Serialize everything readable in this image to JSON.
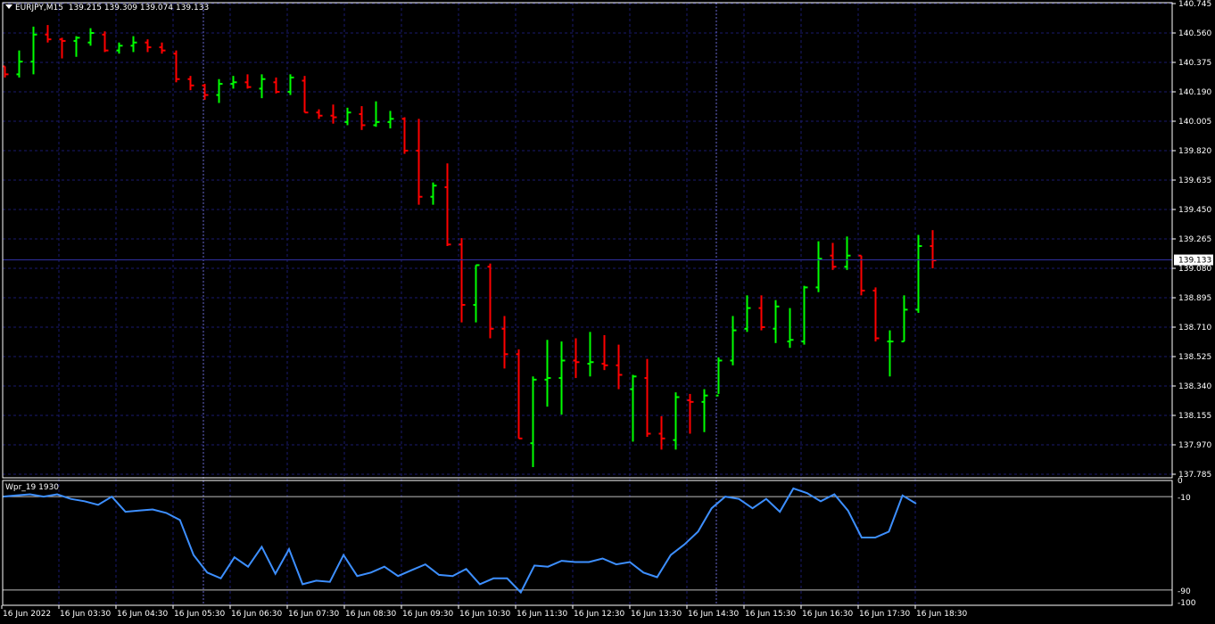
{
  "header": {
    "symbol": "EURJPY,M15",
    "ohlc": "139.215 139.309 139.074 139.133"
  },
  "indicator": {
    "label": "Wpr_19 1930",
    "levels_labels": [
      "0",
      "-10",
      "-90",
      "-100"
    ]
  },
  "current_price_label": "139.133",
  "colors": {
    "background": "#000000",
    "grid": "#1a1a6e",
    "bull": "#00ff00",
    "bear": "#ff0000",
    "wpr_line": "#3d8fff",
    "axis": "#ffffff",
    "separator": "#8080ff"
  },
  "chart_data": [
    {
      "type": "ohlc",
      "title": "EURJPY,M15",
      "ylim": [
        137.785,
        140.745
      ],
      "y_ticks": [
        "140.745",
        "140.560",
        "140.375",
        "140.190",
        "140.005",
        "139.820",
        "139.635",
        "139.450",
        "139.265",
        "139.080",
        "138.895",
        "138.710",
        "138.525",
        "138.340",
        "138.155",
        "137.970",
        "137.785"
      ],
      "x_ticks": [
        "16 Jun 2022",
        "16 Jun 03:30",
        "16 Jun 04:30",
        "16 Jun 05:30",
        "16 Jun 06:30",
        "16 Jun 07:30",
        "16 Jun 08:30",
        "16 Jun 09:30",
        "16 Jun 10:30",
        "16 Jun 11:30",
        "16 Jun 12:30",
        "16 Jun 13:30",
        "16 Jun 14:30",
        "16 Jun 15:30",
        "16 Jun 16:30",
        "16 Jun 17:30",
        "16 Jun 18:30"
      ],
      "current_price": 139.133,
      "bars": [
        [
          140.35,
          140.35,
          140.28,
          140.3
        ],
        [
          140.3,
          140.45,
          140.28,
          140.38
        ],
        [
          140.38,
          140.6,
          140.3,
          140.55
        ],
        [
          140.55,
          140.61,
          140.5,
          140.52
        ],
        [
          140.52,
          140.53,
          140.4,
          140.51
        ],
        [
          140.51,
          140.54,
          140.41,
          140.53
        ],
        [
          140.5,
          140.59,
          140.48,
          140.56
        ],
        [
          140.55,
          140.57,
          140.44,
          140.45
        ],
        [
          140.45,
          140.5,
          140.43,
          140.48
        ],
        [
          140.48,
          140.54,
          140.44,
          140.5
        ],
        [
          140.5,
          140.52,
          140.44,
          140.47
        ],
        [
          140.47,
          140.5,
          140.43,
          140.45
        ],
        [
          140.43,
          140.45,
          140.25,
          140.27
        ],
        [
          140.27,
          140.29,
          140.2,
          140.23
        ],
        [
          140.23,
          140.24,
          140.14,
          140.17
        ],
        [
          140.17,
          140.27,
          140.12,
          140.24
        ],
        [
          140.24,
          140.29,
          140.21,
          140.25
        ],
        [
          140.25,
          140.3,
          140.21,
          140.22
        ],
        [
          140.21,
          140.3,
          140.15,
          140.27
        ],
        [
          140.25,
          140.28,
          140.18,
          140.19
        ],
        [
          140.19,
          140.3,
          140.17,
          140.28
        ],
        [
          140.26,
          140.29,
          140.06,
          140.06
        ],
        [
          140.06,
          140.08,
          140.02,
          140.04
        ],
        [
          140.04,
          140.11,
          139.99,
          140.03
        ],
        [
          140.0,
          140.09,
          139.98,
          140.06
        ],
        [
          140.05,
          140.1,
          139.95,
          139.98
        ],
        [
          139.98,
          140.13,
          139.97,
          140.0
        ],
        [
          140.0,
          140.07,
          139.96,
          140.02
        ],
        [
          140.02,
          140.03,
          139.8,
          139.82
        ],
        [
          139.82,
          140.02,
          139.48,
          139.53
        ],
        [
          139.53,
          139.62,
          139.48,
          139.6
        ],
        [
          139.59,
          139.74,
          139.22,
          139.23
        ],
        [
          139.23,
          139.27,
          138.74,
          138.85
        ],
        [
          138.85,
          139.1,
          138.74,
          139.1
        ],
        [
          139.09,
          139.11,
          138.64,
          138.7
        ],
        [
          138.7,
          138.78,
          138.45,
          138.54
        ],
        [
          138.54,
          138.57,
          138.01,
          138.01
        ],
        [
          137.98,
          138.4,
          137.83,
          138.38
        ],
        [
          138.38,
          138.63,
          138.21,
          138.39
        ],
        [
          138.39,
          138.62,
          138.16,
          138.5
        ],
        [
          138.5,
          138.64,
          138.39,
          138.49
        ],
        [
          138.48,
          138.68,
          138.4,
          138.49
        ],
        [
          138.48,
          138.66,
          138.44,
          138.47
        ],
        [
          138.47,
          138.6,
          138.32,
          138.41
        ],
        [
          138.32,
          138.41,
          137.99,
          138.4
        ],
        [
          138.39,
          138.51,
          138.02,
          138.04
        ],
        [
          138.04,
          138.15,
          137.94,
          138.01
        ],
        [
          138.0,
          138.3,
          137.94,
          138.27
        ],
        [
          138.25,
          138.29,
          138.04,
          138.24
        ],
        [
          138.24,
          138.32,
          138.05,
          138.28
        ],
        [
          138.28,
          138.52,
          138.29,
          138.5
        ],
        [
          138.5,
          138.78,
          138.47,
          138.69
        ],
        [
          138.7,
          138.91,
          138.68,
          138.83
        ],
        [
          138.83,
          138.91,
          138.69,
          138.71
        ],
        [
          138.7,
          138.88,
          138.61,
          138.84
        ],
        [
          138.62,
          138.83,
          138.58,
          138.63
        ],
        [
          138.62,
          138.97,
          138.6,
          138.96
        ],
        [
          138.96,
          139.25,
          138.93,
          139.14
        ],
        [
          139.16,
          139.24,
          139.07,
          139.09
        ],
        [
          139.09,
          139.28,
          139.07,
          139.16
        ],
        [
          139.16,
          139.16,
          138.91,
          138.94
        ],
        [
          138.94,
          138.96,
          138.62,
          138.64
        ],
        [
          138.62,
          138.69,
          138.4,
          138.62
        ],
        [
          138.62,
          138.91,
          138.62,
          138.82
        ],
        [
          138.82,
          139.29,
          138.8,
          139.22
        ],
        [
          139.22,
          139.32,
          139.08,
          139.13
        ]
      ]
    },
    {
      "type": "line",
      "title": "Wpr_19 1930",
      "ylim": [
        -100,
        0
      ],
      "levels": [
        -10,
        -90
      ],
      "series": [
        {
          "values": [
            -10,
            -9,
            -8,
            -10,
            -8,
            -12,
            -14,
            -17,
            -10,
            -23,
            -22,
            -21,
            -24,
            -30,
            -60,
            -75,
            -80,
            -62,
            -70,
            -53,
            -76,
            -55,
            -85,
            -82,
            -83,
            -60,
            -78,
            -75,
            -70,
            -78,
            -73,
            -68,
            -77,
            -78,
            -72,
            -85,
            -80,
            -80,
            -92,
            -69,
            -70,
            -65,
            -66,
            -66,
            -63,
            -68,
            -66,
            -75,
            -79,
            -60,
            -51,
            -40,
            -20,
            -10,
            -12,
            -20,
            -12,
            -23,
            -3,
            -7,
            -14,
            -8,
            -22,
            -45,
            -45,
            -40,
            -9,
            -16
          ]
        }
      ]
    }
  ]
}
